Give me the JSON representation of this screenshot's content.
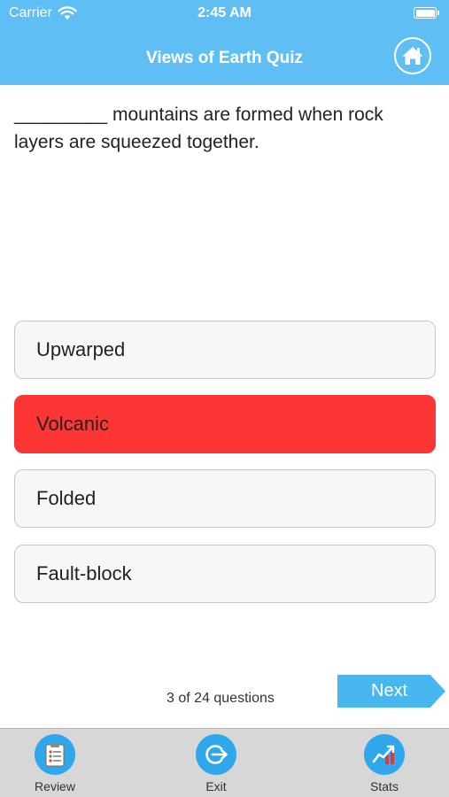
{
  "status_bar": {
    "carrier": "Carrier",
    "time": "2:45 AM",
    "icons": [
      "wifi-icon",
      "battery-icon"
    ]
  },
  "header": {
    "title": "Views of Earth Quiz",
    "home_icon": "home-icon",
    "background_color": "#5fbff5"
  },
  "question": {
    "text": "_________ mountains are formed when rock layers are squeezed together."
  },
  "answers": [
    {
      "label": "Upwarped",
      "state": "default"
    },
    {
      "label": "Volcanic",
      "state": "wrong",
      "color": "#fc3535"
    },
    {
      "label": "Folded",
      "state": "default"
    },
    {
      "label": "Fault-block",
      "state": "default"
    }
  ],
  "progress": {
    "text": "3 of 24 questions",
    "current": 3,
    "total": 24
  },
  "next_label": "Next",
  "tab_bar": {
    "items": [
      {
        "label": "Review",
        "icon": "review-clipboard-icon"
      },
      {
        "label": "Exit",
        "icon": "exit-icon"
      },
      {
        "label": "Stats",
        "icon": "stats-chart-icon"
      }
    ]
  }
}
